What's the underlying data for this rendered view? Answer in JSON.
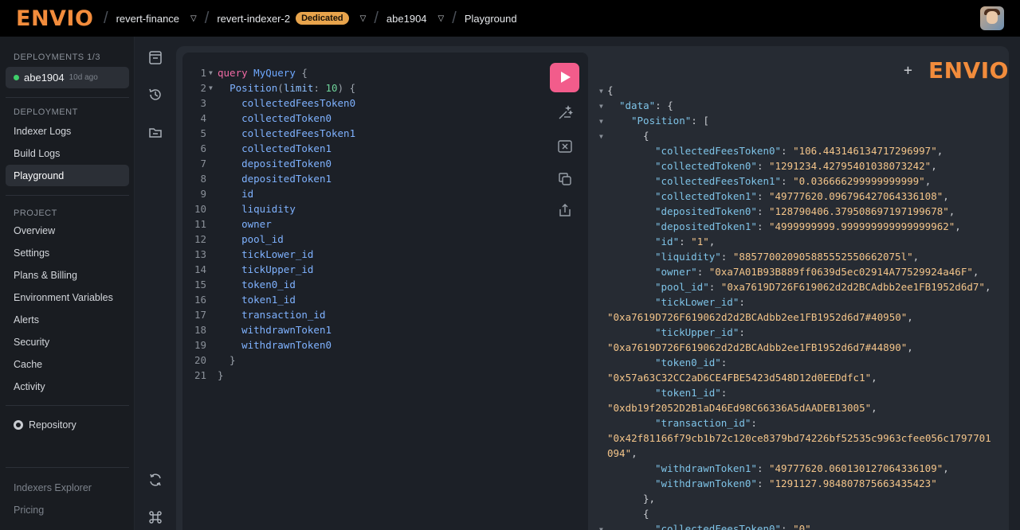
{
  "header": {
    "logo": "ENVIO",
    "breadcrumbs": [
      "revert-finance",
      "revert-indexer-2",
      "abe1904",
      "Playground"
    ],
    "badge": "Dedicated"
  },
  "sidebar": {
    "deployments_label": "DEPLOYMENTS 1/3",
    "current_deployment": {
      "name": "abe1904",
      "ago": "10d ago"
    },
    "deployment_label": "DEPLOYMENT",
    "deployment_items": [
      "Indexer Logs",
      "Build Logs",
      "Playground"
    ],
    "project_label": "PROJECT",
    "project_items": [
      "Overview",
      "Settings",
      "Plans & Billing",
      "Environment Variables",
      "Alerts",
      "Security",
      "Cache",
      "Activity"
    ],
    "repository": "Repository",
    "footer_items": [
      "Indexers Explorer",
      "Pricing"
    ]
  },
  "editor": {
    "line_numbers": [
      "1",
      "2",
      "3",
      "4",
      "5",
      "6",
      "7",
      "8",
      "9",
      "10",
      "11",
      "12",
      "13",
      "14",
      "15",
      "16",
      "17",
      "18",
      "19",
      "20",
      "21"
    ],
    "query_keyword": "query",
    "query_name": "MyQuery",
    "entity": "Position",
    "arg_name": "limit",
    "arg_value": "10",
    "fields": [
      "collectedFeesToken0",
      "collectedToken0",
      "collectedFeesToken1",
      "collectedToken1",
      "depositedToken0",
      "depositedToken1",
      "id",
      "liquidity",
      "owner",
      "pool_id",
      "tickLower_id",
      "tickUpper_id",
      "token0_id",
      "token1_id",
      "transaction_id",
      "withdrawnToken1",
      "withdrawnToken0"
    ]
  },
  "result": {
    "logo": "ENVIO",
    "plus": "+",
    "data_key": "\"data\"",
    "position_key": "\"Position\"",
    "rows": [
      {
        "k": "\"collectedFeesToken0\"",
        "v": "\"106.443146134717296997\""
      },
      {
        "k": "\"collectedToken0\"",
        "v": "\"1291234.42795401038073242\""
      },
      {
        "k": "\"collectedFeesToken1\"",
        "v": "\"0.036666299999999999\""
      },
      {
        "k": "\"collectedToken1\"",
        "v": "\"49777620.096796427064336108\""
      },
      {
        "k": "\"depositedToken0\"",
        "v": "\"128790406.379508697197199678\""
      },
      {
        "k": "\"depositedToken1\"",
        "v": "\"4999999999.999999999999999962\""
      },
      {
        "k": "\"id\"",
        "v": "\"1\""
      },
      {
        "k": "\"liquidity\"",
        "v": "\"885770020905885552550662075l\""
      },
      {
        "k": "\"owner\"",
        "v": "\"0xa7A01B93B889ff0639d5ec02914A77529924a46F\""
      },
      {
        "k": "\"pool_id\"",
        "v": "\"0xa7619D726F619062d2d2BCAdbb2ee1FB1952d6d7\""
      }
    ],
    "wrapped_rows": [
      {
        "k": "\"tickLower_id\"",
        "v": "\"0xa7619D726F619062d2d2BCAdbb2ee1FB1952d6d7#40950\""
      },
      {
        "k": "\"tickUpper_id\"",
        "v": "\"0xa7619D726F619062d2d2BCAdbb2ee1FB1952d6d7#44890\""
      },
      {
        "k": "\"token0_id\"",
        "v": "\"0x57a63C32CC2aD6CE4FBE5423d548D12d0EEDdfc1\""
      },
      {
        "k": "\"token1_id\"",
        "v": "\"0xdb19f2052D2B1aD46Ed98C66336A5dAADEB13005\""
      }
    ],
    "tx_key": "\"transaction_id\"",
    "tx_value_1": "\"0x42f81166f79cb1b72c120ce8379bd74226bf52535c9963cfee056c1797701",
    "tx_value_2": "094\"",
    "tail_rows": [
      {
        "k": "\"withdrawnToken1\"",
        "v": "\"49777620.060130127064336109\""
      },
      {
        "k": "\"withdrawnToken0\"",
        "v": "\"1291127.984807875663435423\""
      }
    ],
    "next_key": "\"collectedFeesToken0\"",
    "next_value": "\"0\""
  }
}
